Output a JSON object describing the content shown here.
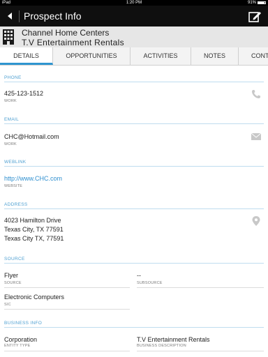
{
  "status_bar": {
    "carrier": "iPad",
    "time": "1:20 PM",
    "battery": "91%"
  },
  "title_bar": {
    "title": "Prospect Info"
  },
  "header": {
    "name_line1": "Channel Home Centers",
    "name_line2": "T.V Entertainment Rentals"
  },
  "tabs": [
    {
      "label": "DETAILS",
      "active": true
    },
    {
      "label": "OPPORTUNITIES",
      "active": false
    },
    {
      "label": "ACTIVITIES",
      "active": false
    },
    {
      "label": "NOTES",
      "active": false
    },
    {
      "label": "CONT",
      "active": false
    }
  ],
  "sections": {
    "phone": {
      "label": "PHONE",
      "value": "425-123-1512",
      "sublabel": "WORK"
    },
    "email": {
      "label": "EMAIL",
      "value": "CHC@Hotmail.com",
      "sublabel": "WORK"
    },
    "weblink": {
      "label": "WEBLINK",
      "value": "http://www.CHC.com",
      "sublabel": "WEBSITE"
    },
    "address": {
      "label": "ADDRESS",
      "line1": "4023 Hamilton Drive",
      "line2": "Texas City, TX 77591",
      "line3": "Texas City TX, 77591"
    },
    "source": {
      "label": "SOURCE",
      "source_value": "Flyer",
      "source_sublabel": "SOURCE",
      "subsource_value": "--",
      "subsource_sublabel": "SUBSOURCE",
      "sic_value": "Electronic Computers",
      "sic_sublabel": "SIC"
    },
    "business_info": {
      "label": "BUSINESS INFO",
      "entity_value": "Corporation",
      "entity_sublabel": "ENTITY TYPE",
      "desc_value": "T.V Entertainment Rentals",
      "desc_sublabel": "BUSINESS DESCRIPTION"
    }
  },
  "icons": {
    "phone": "phone-icon",
    "email": "envelope-icon",
    "address": "map-pin-icon",
    "back": "chevron-left-icon",
    "edit": "edit-icon",
    "building": "building-icon"
  },
  "colors": {
    "accent": "#2f95d0",
    "section_label": "#4d9fd1",
    "title_bar": "#0f0f0f",
    "header_bg": "#e6e6e6"
  }
}
